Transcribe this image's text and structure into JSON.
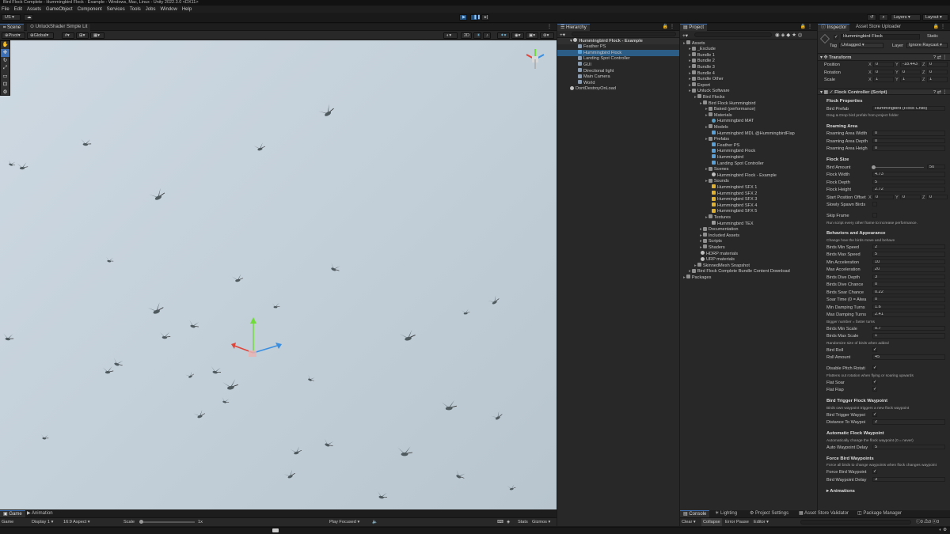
{
  "window_title": "Bird Flock Complete - Hummingbird Flock - Example - Windows, Mac, Linux - Unity 2022.3.0 <DX11>",
  "menu": [
    "File",
    "Edit",
    "Assets",
    "GameObject",
    "Component",
    "Services",
    "Tools",
    "Jobs",
    "Window",
    "Help"
  ],
  "toolbar": {
    "account": "US",
    "layers": "Layers",
    "layout": "Layout"
  },
  "scene": {
    "tab": "Scene",
    "shader": "UnluckShader Simple Lit",
    "pivot": "Pivot",
    "global": "Global",
    "mode_2d": "2D"
  },
  "game": {
    "tabs": [
      "Game",
      "Animation"
    ],
    "game_label": "Game",
    "display": "Display 1",
    "aspect": "16:9 Aspect",
    "scale_label": "Scale",
    "scale_value": "1x",
    "play_focused": "Play Focused",
    "stats": "Stats",
    "gizmos": "Gizmos"
  },
  "hierarchy": {
    "tab": "Hierarchy",
    "scene": "Hummingbird Flock - Example",
    "items": [
      {
        "label": "Feather PS",
        "depth": 2,
        "icon": "go"
      },
      {
        "label": "Hummingbird Flock",
        "depth": 2,
        "icon": "pre",
        "selected": true
      },
      {
        "label": "Landing Spot Controller",
        "depth": 2,
        "icon": "go"
      },
      {
        "label": "GUI",
        "depth": 2,
        "icon": "go"
      },
      {
        "label": "Directional light",
        "depth": 2,
        "icon": "go"
      },
      {
        "label": "Main Camera",
        "depth": 2,
        "icon": "go"
      },
      {
        "label": "World",
        "depth": 2,
        "icon": "go"
      },
      {
        "label": "DontDestroyOnLoad",
        "depth": 1,
        "icon": "scene"
      }
    ]
  },
  "project": {
    "tab": "Project",
    "tree": [
      {
        "label": "Assets",
        "depth": 0,
        "icon": "folder"
      },
      {
        "label": "_Exclude",
        "depth": 1,
        "icon": "folder"
      },
      {
        "label": "Bundle 1",
        "depth": 1,
        "icon": "folder"
      },
      {
        "label": "Bundle 2",
        "depth": 1,
        "icon": "folder"
      },
      {
        "label": "Bundle 3",
        "depth": 1,
        "icon": "folder"
      },
      {
        "label": "Bundle 4",
        "depth": 1,
        "icon": "folder"
      },
      {
        "label": "Bundle Other",
        "depth": 1,
        "icon": "folder"
      },
      {
        "label": "Export",
        "depth": 1,
        "icon": "folder"
      },
      {
        "label": "Unluck Software",
        "depth": 1,
        "icon": "folder"
      },
      {
        "label": "Bird Flocks",
        "depth": 2,
        "icon": "folder"
      },
      {
        "label": "Bird Flock Hummingbird",
        "depth": 3,
        "icon": "folder"
      },
      {
        "label": "Baked (performance)",
        "depth": 4,
        "icon": "folder"
      },
      {
        "label": "Materials",
        "depth": 4,
        "icon": "folder"
      },
      {
        "label": "Hummingbird MAT",
        "depth": 5,
        "icon": "mat"
      },
      {
        "label": "Models",
        "depth": 4,
        "icon": "folder"
      },
      {
        "label": "Hummingbird MDL @HummingbirdFlap",
        "depth": 5,
        "icon": "pre"
      },
      {
        "label": "Prefabs",
        "depth": 4,
        "icon": "folder"
      },
      {
        "label": "Feather PS",
        "depth": 5,
        "icon": "pre"
      },
      {
        "label": "Hummingbird Flock",
        "depth": 5,
        "icon": "pre"
      },
      {
        "label": "Hummingbird",
        "depth": 5,
        "icon": "pre"
      },
      {
        "label": "Landing Spot Controller",
        "depth": 5,
        "icon": "pre"
      },
      {
        "label": "Scenes",
        "depth": 4,
        "icon": "folder"
      },
      {
        "label": "Hummingbird Flock - Example",
        "depth": 5,
        "icon": "scene"
      },
      {
        "label": "Sounds",
        "depth": 4,
        "icon": "folder"
      },
      {
        "label": "Hummingbird SFX 1",
        "depth": 5,
        "icon": "snd"
      },
      {
        "label": "Hummingbird SFX 2",
        "depth": 5,
        "icon": "snd"
      },
      {
        "label": "Hummingbird SFX 3",
        "depth": 5,
        "icon": "snd"
      },
      {
        "label": "Hummingbird SFX 4",
        "depth": 5,
        "icon": "snd"
      },
      {
        "label": "Hummingbird SFX 5",
        "depth": 5,
        "icon": "snd"
      },
      {
        "label": "Textures",
        "depth": 4,
        "icon": "folder"
      },
      {
        "label": "Hummingbird TEX",
        "depth": 5,
        "icon": "tex"
      },
      {
        "label": "Documentation",
        "depth": 3,
        "icon": "folder"
      },
      {
        "label": "Included Assets",
        "depth": 3,
        "icon": "folder"
      },
      {
        "label": "Scripts",
        "depth": 3,
        "icon": "folder"
      },
      {
        "label": "Shaders",
        "depth": 3,
        "icon": "folder"
      },
      {
        "label": "HDRP materials",
        "depth": 3,
        "icon": "scene"
      },
      {
        "label": "URP materials",
        "depth": 3,
        "icon": "scene"
      },
      {
        "label": "SkinnedMesh Snapshot",
        "depth": 2,
        "icon": "folder"
      },
      {
        "label": "Bird Flock Complete Bundle Content Download",
        "depth": 1,
        "icon": "folder"
      },
      {
        "label": "Packages",
        "depth": 0,
        "icon": "folder"
      }
    ]
  },
  "inspector": {
    "tabs": [
      "Inspector",
      "Asset Store Uploader"
    ],
    "object_name": "Hummingbird Flock",
    "static_label": "Static",
    "tag_label": "Tag",
    "tag_value": "Untagged",
    "layer_label": "Layer",
    "layer_value": "Ignore Raycast",
    "transform_title": "Transform",
    "transform": [
      {
        "label": "Position",
        "x": "0",
        "y": "-18.443",
        "z": "0"
      },
      {
        "label": "Rotation",
        "x": "0",
        "y": "0",
        "z": "0"
      },
      {
        "label": "Scale",
        "x": "1",
        "y": "1",
        "z": "1"
      }
    ],
    "script_title": "Flock Controller (Script)",
    "rows": [
      {
        "kind": "head",
        "label": "Flock Properties"
      },
      {
        "kind": "field",
        "label": "Bird Prefab",
        "value": "Hummingbird (Flock Child)"
      },
      {
        "kind": "help",
        "label": "Drag & Drop bird prefab from project folder"
      },
      {
        "kind": "gap"
      },
      {
        "kind": "head",
        "label": "Roaming Area"
      },
      {
        "kind": "field",
        "label": "Roaming Area Width",
        "value": "0"
      },
      {
        "kind": "field",
        "label": "Roaming Area Depth",
        "value": "0"
      },
      {
        "kind": "field",
        "label": "Roaming Area Heigh",
        "value": "0"
      },
      {
        "kind": "gap"
      },
      {
        "kind": "head",
        "label": "Flock Size"
      },
      {
        "kind": "slider",
        "label": "Bird Amount",
        "value": "50",
        "fraction": 0.0
      },
      {
        "kind": "field",
        "label": "Flock Width",
        "value": "4.73"
      },
      {
        "kind": "field",
        "label": "Flock Depth",
        "value": "5"
      },
      {
        "kind": "field",
        "label": "Flock Height",
        "value": "2.72"
      },
      {
        "kind": "xyz",
        "label": "Start Position Offset",
        "x": "0",
        "y": "0",
        "z": "0"
      },
      {
        "kind": "check",
        "label": "Slowly Spawn Birds",
        "value": ""
      },
      {
        "kind": "gap"
      },
      {
        "kind": "check",
        "label": "Skip Frame",
        "value": ""
      },
      {
        "kind": "help",
        "label": "Run script every other frame to increase performance."
      },
      {
        "kind": "gap"
      },
      {
        "kind": "head",
        "label": "Behaviors and Appearance"
      },
      {
        "kind": "help",
        "label": "Change how the birds move and behave"
      },
      {
        "kind": "field",
        "label": "Birds Min Speed",
        "value": "2"
      },
      {
        "kind": "field",
        "label": "Birds Max Speed",
        "value": "5"
      },
      {
        "kind": "field",
        "label": "Min Acceleration",
        "value": "10"
      },
      {
        "kind": "field",
        "label": "Max Acceleration",
        "value": "20"
      },
      {
        "kind": "field",
        "label": "Birds Dive Depth",
        "value": "3"
      },
      {
        "kind": "field",
        "label": "Birds Dive Chance",
        "value": "0"
      },
      {
        "kind": "field",
        "label": "Birds Soar Chance",
        "value": "0.22"
      },
      {
        "kind": "field",
        "label": "Soar Time (0 = Alwa",
        "value": "0"
      },
      {
        "kind": "field",
        "label": "Min Damping Turns",
        "value": "1.6"
      },
      {
        "kind": "field",
        "label": "Max Damping Turns",
        "value": "2.41"
      },
      {
        "kind": "help",
        "label": "Bigger number = faster turns"
      },
      {
        "kind": "field",
        "label": "Birds Min Scale",
        "value": "0.7"
      },
      {
        "kind": "field",
        "label": "Birds Max Scale",
        "value": "1"
      },
      {
        "kind": "help",
        "label": "Randomize size of birds when added"
      },
      {
        "kind": "check",
        "label": "Bird Roll",
        "value": "✓"
      },
      {
        "kind": "field",
        "label": "Roll Amount",
        "value": "45"
      },
      {
        "kind": "gap"
      },
      {
        "kind": "check",
        "label": "Disable Pitch Rotati",
        "value": "✓"
      },
      {
        "kind": "help",
        "label": "Flattens out rotation when flying or soaring upwards"
      },
      {
        "kind": "check",
        "label": "Flat Soar",
        "value": "✓"
      },
      {
        "kind": "check",
        "label": "Flat Flap",
        "value": "✓"
      },
      {
        "kind": "gap"
      },
      {
        "kind": "head",
        "label": "Bird Trigger Flock Waypoint"
      },
      {
        "kind": "help",
        "label": "Birds own waypoint triggers a new flock waypoint"
      },
      {
        "kind": "check",
        "label": "Bird Trigger Waypoi",
        "value": "✓"
      },
      {
        "kind": "field",
        "label": "Distance To Waypoi",
        "value": "2"
      },
      {
        "kind": "gap"
      },
      {
        "kind": "head",
        "label": "Automatic Flock Waypoint"
      },
      {
        "kind": "help",
        "label": "Automatically change the flock waypoint (0 = never)"
      },
      {
        "kind": "field",
        "label": "Auto Waypoint Delay",
        "value": "5"
      },
      {
        "kind": "gap"
      },
      {
        "kind": "head",
        "label": "Force Bird Waypoints"
      },
      {
        "kind": "help",
        "label": "Force all birds to change waypoints when flock changes waypoint"
      },
      {
        "kind": "check",
        "label": "Force Bird Waypoint",
        "value": "✓"
      },
      {
        "kind": "field",
        "label": "Bird Waypoint Delay",
        "value": "3"
      },
      {
        "kind": "gap"
      },
      {
        "kind": "head",
        "label": "▸ Animations"
      }
    ]
  },
  "console": {
    "tabs": [
      "Console",
      "Lighting",
      "Project Settings",
      "Asset Store Validator",
      "Package Manager"
    ],
    "clear": "Clear",
    "collapse": "Collapse",
    "error_pause": "Error Pause",
    "editor": "Editor"
  },
  "colors": {
    "accent": "#3d6fb4",
    "selection": "#2c5d87",
    "panel": "#282828",
    "sky": "#c8d4de"
  }
}
